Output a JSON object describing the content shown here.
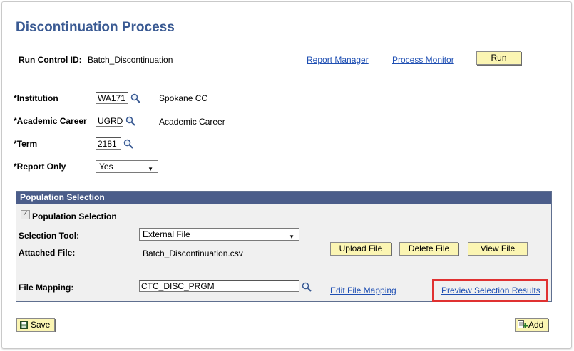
{
  "page": {
    "title": "Discontinuation Process",
    "run_control_label": "Run Control ID:",
    "run_control_value": "Batch_Discontinuation",
    "report_manager": "Report Manager",
    "process_monitor": "Process Monitor",
    "run_button": "Run"
  },
  "fields": {
    "institution_label": "*Institution",
    "institution_value": "WA171",
    "institution_desc": "Spokane CC",
    "career_label": "*Academic Career",
    "career_value": "UGRD",
    "career_desc": "Academic Career",
    "term_label": "*Term",
    "term_value": "2181",
    "report_only_label": "*Report Only",
    "report_only_value": "Yes"
  },
  "population": {
    "header": "Population Selection",
    "checkbox_label": "Population Selection",
    "checked": true,
    "selection_tool_label": "Selection Tool:",
    "selection_tool_value": "External File",
    "attached_file_label": "Attached File:",
    "attached_file_value": "Batch_Discontinuation.csv",
    "upload_button": "Upload File",
    "delete_button": "Delete File",
    "view_button": "View File",
    "file_mapping_label": "File Mapping:",
    "file_mapping_value": "CTC_DISC_PRGM",
    "edit_mapping_link": "Edit File Mapping",
    "preview_link": "Preview Selection Results"
  },
  "footer": {
    "save_button": "Save",
    "add_button": "Add"
  },
  "icons": {
    "lookup": "magnifier-icon",
    "save": "save-icon",
    "add": "add-icon"
  },
  "colors": {
    "title": "#3a5a93",
    "link": "#1f4fb3",
    "button": "#fbf5b3",
    "group_header": "#4b5d8a",
    "highlight": "#e03131"
  }
}
